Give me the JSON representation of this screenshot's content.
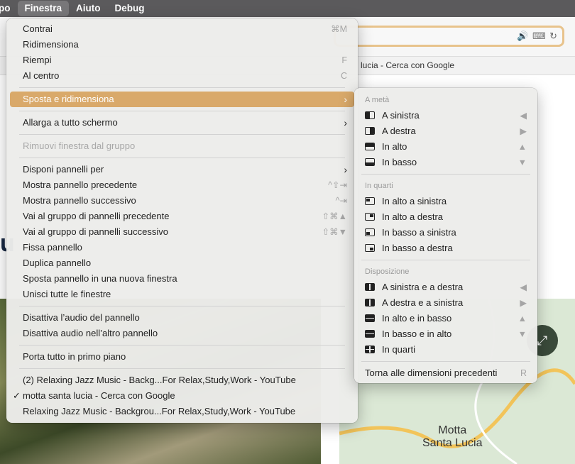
{
  "menubar": {
    "items": [
      "po",
      "Finestra",
      "Aiuto",
      "Debug"
    ],
    "active": "Finestra"
  },
  "browser": {
    "tab_title": "lucia - Cerca con Google",
    "map_label_line1": "Motta",
    "map_label_line2": "Santa Lucia"
  },
  "main_menu": {
    "contrai": {
      "label": "Contrai",
      "shortcut": "⌘M"
    },
    "ridimensiona": {
      "label": "Ridimensiona"
    },
    "riempi": {
      "label": "Riempi",
      "shortcut": "F"
    },
    "centro": {
      "label": "Al centro",
      "shortcut": "C"
    },
    "sposta": {
      "label": "Sposta e ridimensiona"
    },
    "allarga": {
      "label": "Allarga a tutto schermo"
    },
    "rimuovi": {
      "label": "Rimuovi finestra dal gruppo"
    },
    "disponi": {
      "label": "Disponi pannelli per"
    },
    "precedente": {
      "label": "Mostra pannello precedente",
      "shortcut": "^⇧⇥"
    },
    "successivo": {
      "label": "Mostra pannello successivo",
      "shortcut": "^⇥"
    },
    "gruppo_prec": {
      "label": "Vai al gruppo di pannelli precedente",
      "shortcut": "⇧⌘▲"
    },
    "gruppo_succ": {
      "label": "Vai al gruppo di pannelli successivo",
      "shortcut": "⇧⌘▼"
    },
    "fissa": {
      "label": "Fissa pannello"
    },
    "duplica": {
      "label": "Duplica pannello"
    },
    "nuova": {
      "label": "Sposta pannello in una nuova finestra"
    },
    "unisci": {
      "label": "Unisci tutte le finestre"
    },
    "audio": {
      "label": "Disattiva l’audio del pannello"
    },
    "audio_altro": {
      "label": "Disattiva audio nell’altro pannello"
    },
    "porta": {
      "label": "Porta tutto in primo piano"
    },
    "windows": [
      {
        "label": "(2) Relaxing Jazz Music - Backg...For Relax,Study,Work - YouTube",
        "checked": false
      },
      {
        "label": "motta santa lucia - Cerca con Google",
        "checked": true
      },
      {
        "label": "Relaxing Jazz Music - Backgrou...For Relax,Study,Work - YouTube",
        "checked": false
      }
    ]
  },
  "submenu": {
    "h1": "A metà",
    "half": [
      {
        "label": "A sinistra",
        "shortcut": "◀"
      },
      {
        "label": "A destra",
        "shortcut": "▶"
      },
      {
        "label": "In alto",
        "shortcut": "▲"
      },
      {
        "label": "In basso",
        "shortcut": "▼"
      }
    ],
    "h2": "In quarti",
    "quarters": [
      {
        "label": "In alto a sinistra"
      },
      {
        "label": "In alto a destra"
      },
      {
        "label": "In basso a sinistra"
      },
      {
        "label": "In basso a destra"
      }
    ],
    "h3": "Disposizione",
    "arrange": [
      {
        "label": "A sinistra e a destra",
        "shortcut": "◀"
      },
      {
        "label": "A destra e a sinistra",
        "shortcut": "▶"
      },
      {
        "label": "In alto e in basso",
        "shortcut": "▲"
      },
      {
        "label": "In basso e in alto",
        "shortcut": "▼"
      },
      {
        "label": "In quarti"
      }
    ],
    "restore": {
      "label": "Torna alle dimensioni precedenti",
      "shortcut": "R"
    }
  },
  "colors": {
    "highlight": "#d9a96a",
    "menubar": "#5b5a5c"
  }
}
